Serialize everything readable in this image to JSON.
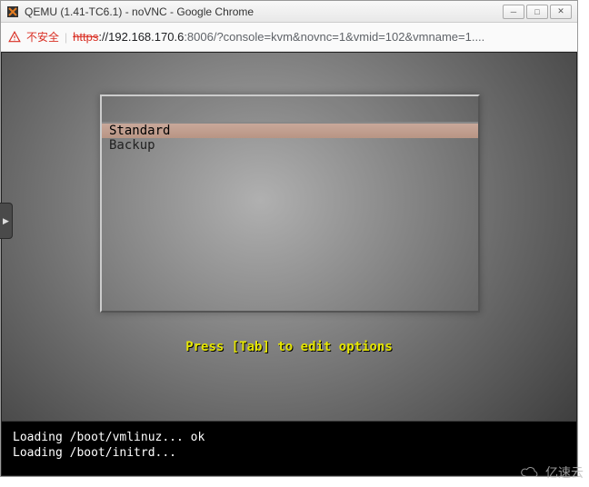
{
  "window": {
    "title": "QEMU (1.41-TC6.1) - noVNC - Google Chrome"
  },
  "addressbar": {
    "warn_text": "不安全",
    "url_https": "https",
    "url_host": "://192.168.170.6",
    "url_path": ":8006/?console=kvm&novnc=1&vmid=102&vmname=1...."
  },
  "boot_menu": {
    "items": [
      "Standard",
      "Backup"
    ],
    "selected_index": 0,
    "hint": "Press [Tab] to edit options"
  },
  "console": {
    "line1": "Loading /boot/vmlinuz... ok",
    "line2": "Loading /boot/initrd..."
  },
  "watermark": {
    "text": "亿速云"
  }
}
